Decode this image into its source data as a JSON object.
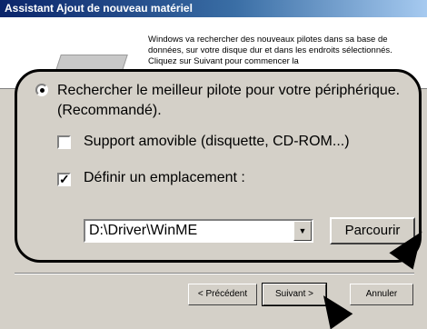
{
  "window": {
    "title": "Assistant Ajout de nouveau matériel"
  },
  "intro": {
    "text": "Windows va rechercher des nouveaux pilotes dans sa base de données, sur votre disque dur et dans les endroits sélectionnés. Cliquez sur Suivant pour commencer la"
  },
  "options": {
    "best_driver_label": "Rechercher le meilleur pilote pour votre périphérique.",
    "recommended_label": "(Recommandé).",
    "removable_label": "Support amovible (disquette, CD-ROM...)",
    "removable_checked": false,
    "location_label": "Définir un emplacement :",
    "location_checked": true,
    "location_value": "D:\\Driver\\WinME",
    "browse_label": "Parcourir"
  },
  "buttons": {
    "back": "< Précédent",
    "next": "Suivant >",
    "cancel": "Annuler"
  },
  "icons": [
    "checkbox-check-icon",
    "dropdown-arrow-icon",
    "pointer-arrow-icon"
  ]
}
